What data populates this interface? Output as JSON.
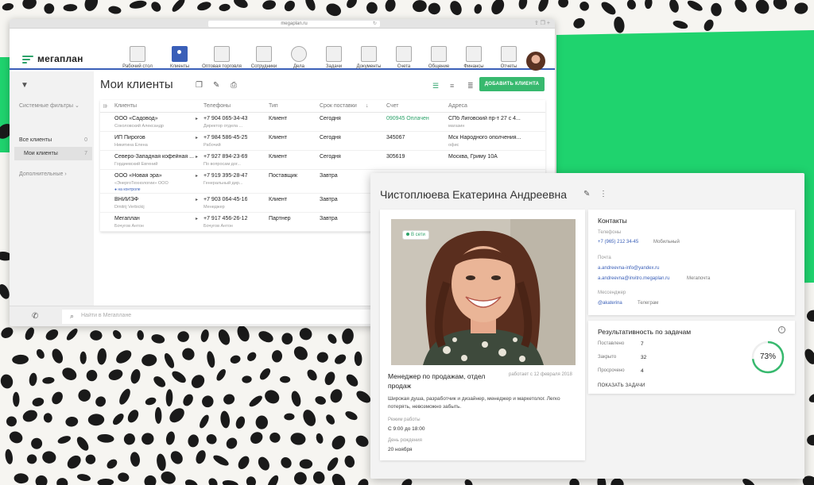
{
  "browser": {
    "url": "megaplan.ru"
  },
  "app": {
    "logo": "мегаплан",
    "nav": [
      {
        "label": "Рабочий стол",
        "icon": "desktop-icon"
      },
      {
        "label": "Клиенты",
        "icon": "clients-icon",
        "active": true
      },
      {
        "label": "Оптовая торговля",
        "icon": "wholesale-icon"
      },
      {
        "label": "Сотрудники",
        "icon": "employees-icon"
      },
      {
        "label": "Дела",
        "icon": "clock-icon"
      },
      {
        "label": "Задачи",
        "icon": "tasks-icon"
      },
      {
        "label": "Документы",
        "icon": "folder-icon"
      },
      {
        "label": "Счета",
        "icon": "invoice-icon"
      },
      {
        "label": "Общение",
        "icon": "chat-icon"
      },
      {
        "label": "Финансы",
        "icon": "finance-icon"
      },
      {
        "label": "Отчеты",
        "icon": "reports-icon"
      }
    ]
  },
  "sidebar": {
    "filters_title": "Системные фильтры",
    "items": [
      {
        "label": "Все клиенты",
        "count": "0"
      },
      {
        "label": "Мои клиенты",
        "count": "7"
      }
    ],
    "extra": "Дополнительные"
  },
  "content": {
    "title": "Мои клиенты",
    "add_button": "ДОБАВИТЬ КЛИЕНТА",
    "columns": [
      "Клиенты",
      "Телефоны",
      "Тип",
      "Срок поставки",
      "Счет",
      "Адреса"
    ],
    "rows": [
      {
        "name": "ООО «Садовод»",
        "contact": "Соколовский Александр",
        "phone": "+7 904 065-34-43",
        "phone_note": "Директор отдела ...",
        "type": "Клиент",
        "due": "Сегодня",
        "invoice": "090945 Оплачен",
        "address": "СПб Лиговский пр-т 27 с 4...",
        "address_note": "магазин"
      },
      {
        "name": "ИП Пирогов",
        "contact": "Никитина Елена",
        "phone": "+7 984 586-45-25",
        "phone_note": "Рабочий",
        "type": "Клиент",
        "due": "Сегодня",
        "invoice": "345067",
        "address": "Мск Народного ополчения...",
        "address_note": "офис"
      },
      {
        "name": "Северо-Западная кофейная ...",
        "contact": "Гордиевский Евгений",
        "phone": "+7 927 894-23-69",
        "phone_note": "По вопросам дог...",
        "type": "Клиент",
        "due": "Сегодня",
        "invoice": "305619",
        "address": "Москва, Гриму 10А",
        "address_note": ""
      },
      {
        "name": "ООО «Новая эра»",
        "contact": "«ЭнергоТехнологии» ООО",
        "phone": "+7 919 395-28-47",
        "phone_note": "Генеральный дир...",
        "type": "Поставщик",
        "due": "Завтра",
        "invoice": "",
        "address": "",
        "address_note": "",
        "control": "● на контроле"
      },
      {
        "name": "ВНИИЭФ",
        "contact": "Dmitrij Verbickij",
        "phone": "+7 903 064-45-16",
        "phone_note": "Менеджер",
        "type": "Клиент",
        "due": "Завтра",
        "invoice": "",
        "address": "",
        "address_note": ""
      },
      {
        "name": "Мегаплан",
        "contact": "Бочугов Антон",
        "phone": "+7 917 456-26-12",
        "phone_note": "Бочугов Антон",
        "type": "Партнер",
        "due": "Завтра",
        "invoice": "",
        "address": "",
        "address_note": ""
      }
    ]
  },
  "bottom": {
    "search_placeholder": "Найти в Мегаплане"
  },
  "profile": {
    "name": "Чистоплюева Екатерина Андреевна",
    "status": "В сети",
    "role": "Менеджер по продажам, отдел продаж",
    "since": "работает с 12 февраля 2018",
    "bio": "Широкая душа, разработчик и дизайнер, менеджер и маркетолог. Легко потерять, невозможно забыть.",
    "schedule_label": "Режим работы",
    "schedule": "С 9:00 до 18:00",
    "birthday_label": "День рождения",
    "birthday": "20 ноября",
    "contacts": {
      "title": "Контакты",
      "phones_label": "Телефоны",
      "phone": "+7 (965) 212 34-45",
      "phone_type": "Мобильный",
      "email_label": "Почта",
      "email1": "a.andreevna-info@yandex.ru",
      "email2": "a.andreevna@invitro.megaplan.ru",
      "email2_type": "Мегапочта",
      "messenger_label": "Мессенджер",
      "messenger": "@akaterina",
      "messenger_type": "Телеграм"
    },
    "performance": {
      "title": "Результативность по задачам",
      "set_label": "Поставлено",
      "set_value": "7",
      "closed_label": "Закрыто",
      "closed_value": "32",
      "overdue_label": "Просрочено",
      "overdue_value": "4",
      "percent": 73,
      "percent_text": "73%",
      "show_tasks": "ПОКАЗАТЬ ЗАДАЧИ"
    }
  },
  "colors": {
    "accent": "#37b96e",
    "brand_blue": "#3a5fb8",
    "bg_green": "#1fd36e"
  }
}
